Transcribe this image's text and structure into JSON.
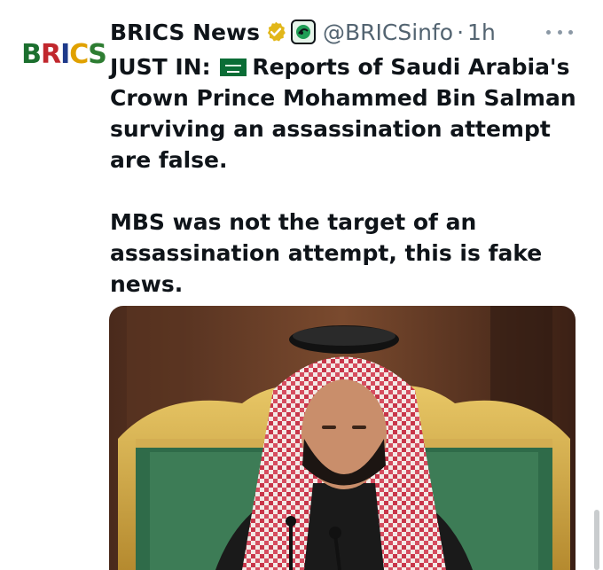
{
  "tweet": {
    "author": {
      "display_name": "BRICS News",
      "handle": "@BRICSinfo",
      "separator": "·",
      "time": "1h",
      "avatar_text": "BRICS"
    },
    "text": {
      "line1_prefix": "JUST IN:",
      "line1_rest": "Reports of Saudi Arabia's Crown Prince Mohammed Bin Salman surviving an assassination attempt are false.",
      "line2": "MBS was not the target of an assassination attempt, this is fake news."
    },
    "icons": {
      "verified": "verified-badge-icon",
      "affiliation": "affiliation-badge-icon",
      "flag": "saudi-flag-icon",
      "more": "more-options-icon"
    },
    "colors": {
      "text": "#0f1419",
      "secondary": "#536471",
      "verified_gold": "#e2b719",
      "flag_green": "#0a6d36"
    }
  }
}
